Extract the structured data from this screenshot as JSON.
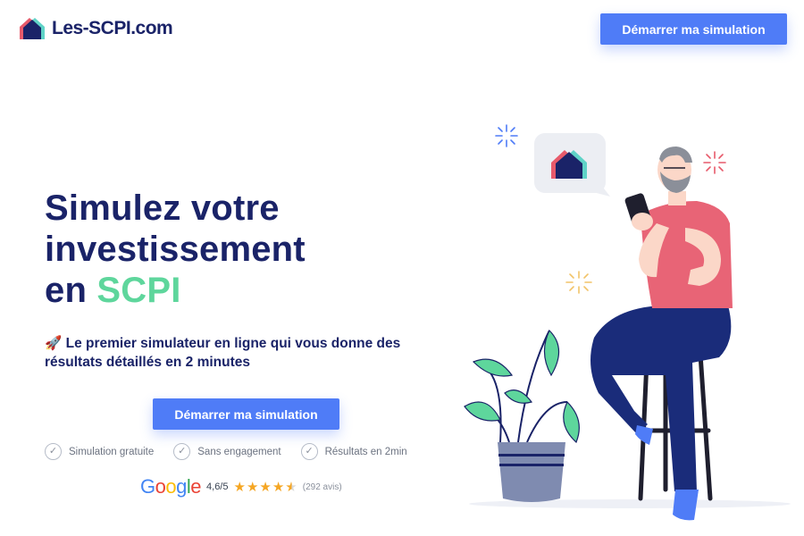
{
  "brand": {
    "name": "Les-SCPI.com",
    "colors": {
      "navy": "#1a2368",
      "accent_green": "#5ed69c",
      "cta_blue": "#4f7cf7",
      "logo_pink": "#e75a6b",
      "logo_teal": "#5fd3c7"
    }
  },
  "header": {
    "cta_label": "Démarrer ma simulation"
  },
  "hero": {
    "title_line1": "Simulez votre",
    "title_line2": "investissement",
    "title_line3_prefix": "en",
    "title_line3_accent": "SCPI",
    "subtitle": "🚀 Le premier simulateur en ligne qui vous donne des résultats détaillés en 2 minutes",
    "cta_label": "Démarrer ma simulation"
  },
  "features": [
    {
      "label": "Simulation gratuite",
      "icon": "check-circle-icon"
    },
    {
      "label": "Sans engagement",
      "icon": "check-circle-icon"
    },
    {
      "label": "Résultats en 2min",
      "icon": "check-circle-icon"
    }
  ],
  "rating": {
    "provider": "Google",
    "score": "4,6/5",
    "stars": 4.6,
    "count": "(292 avis)"
  },
  "illustration": {
    "icon": "man-with-phone-illustration"
  }
}
